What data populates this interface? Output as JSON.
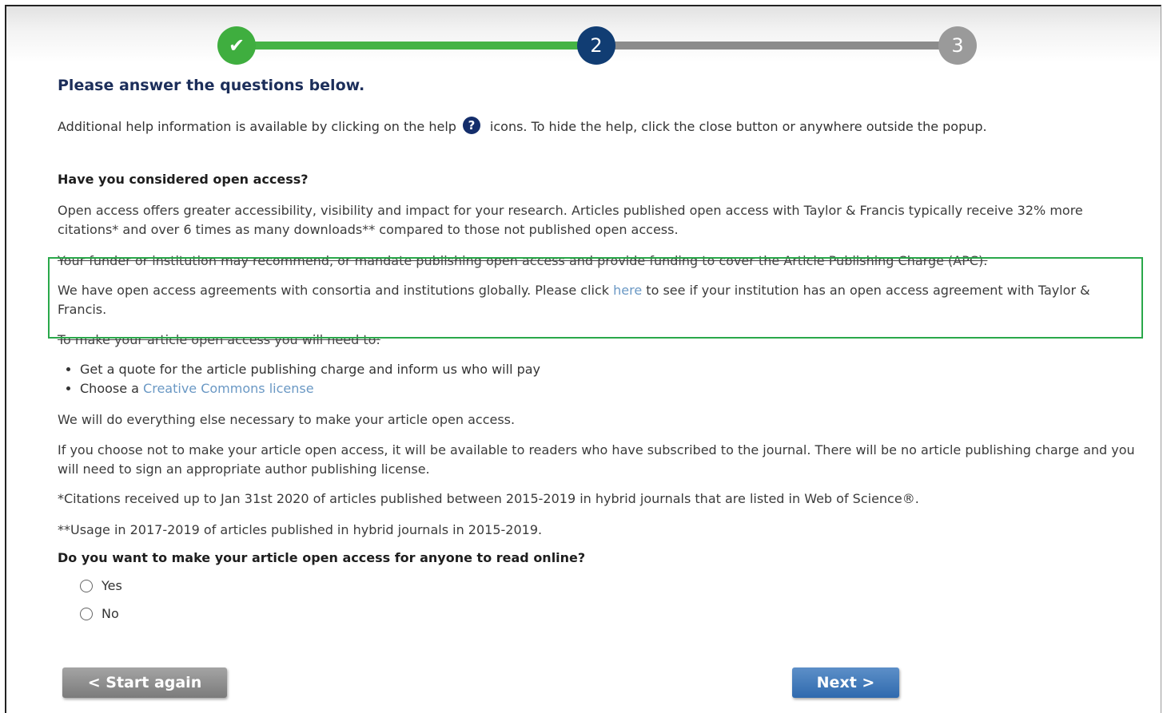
{
  "stepper": {
    "steps": [
      {
        "label": "✔",
        "state": "complete"
      },
      {
        "label": "2",
        "state": "current"
      },
      {
        "label": "3",
        "state": "upcoming"
      }
    ]
  },
  "header": {
    "title": "Please answer the questions below.",
    "help_before": "Additional help information is available by clicking on the help",
    "help_icon": "?",
    "help_after": "icons. To hide the help, click the close button or anywhere outside the popup."
  },
  "question1": {
    "heading": "Have you considered open access?",
    "para1": "Open access offers greater accessibility, visibility and impact for your research. Articles published open access with Taylor & Francis typically receive 32% more citations* and over 6 times as many downloads** compared to those not published open access.",
    "para2": "Your funder or institution may recommend, or mandate publishing open access and provide funding to cover the Article Publishing Charge (APC).",
    "para3_before": "We have open access agreements with consortia and institutions globally. Please click ",
    "para3_link": "here",
    "para3_after": " to see if your institution has an open access agreement with Taylor & Francis.",
    "para4": "To make your article open access you will need to:",
    "bullet1": "Get a quote for the article publishing charge and inform us who will pay",
    "bullet2_before": "Choose a ",
    "bullet2_link": "Creative Commons license",
    "para5": "We will do everything else necessary to make your article open access.",
    "para6": "If you choose not to make your article open access, it will be available to readers who have subscribed to the journal. There will be no article publishing charge and you will need to sign an appropriate author publishing license.",
    "footnote1": "*Citations received up to Jan 31st 2020 of articles published between 2015-2019 in hybrid journals that are listed in Web of Science®.",
    "footnote2": "**Usage in 2017-2019 of articles published in hybrid journals in 2015-2019."
  },
  "question2": {
    "heading": "Do you want to make your article open access for anyone to read online?",
    "options": [
      "Yes",
      "No"
    ],
    "selected": null
  },
  "buttons": {
    "start_again": "< Start again",
    "next": "Next >"
  },
  "colors": {
    "progress_complete": "#45b345",
    "step_current": "#113d73",
    "step_upcoming": "#9a9a9a",
    "highlight_box": "#2aa84a",
    "link": "#6a98c4",
    "next_button": "#2f6aae"
  }
}
